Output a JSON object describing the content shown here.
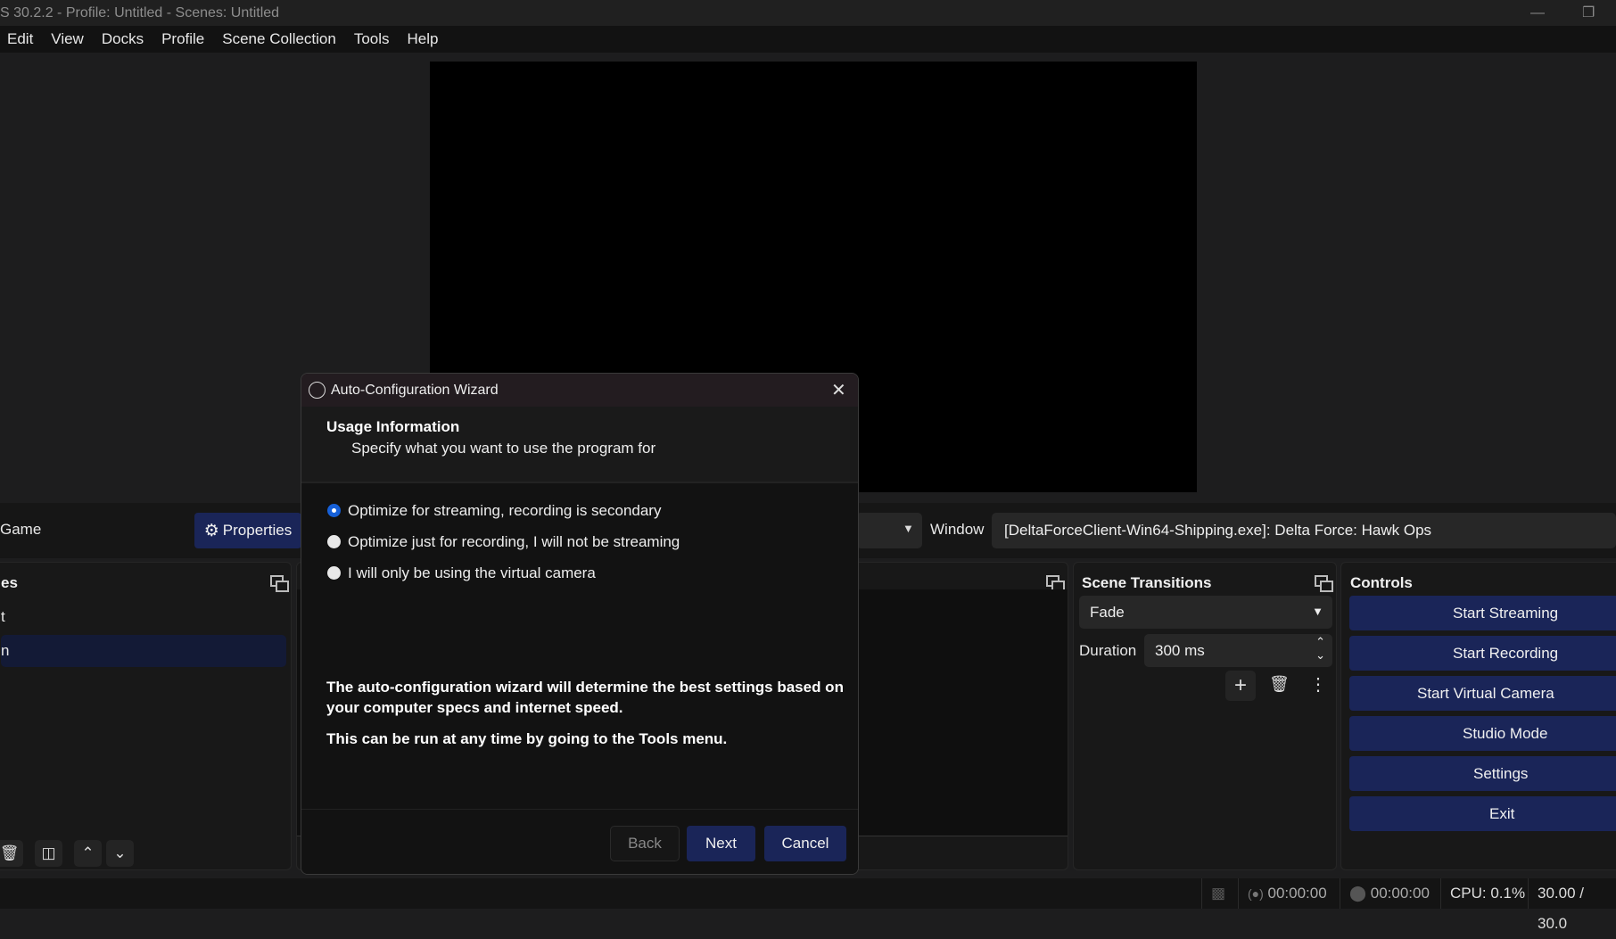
{
  "window": {
    "title": "S 30.2.2 - Profile: Untitled - Scenes: Untitled"
  },
  "menu": [
    "Edit",
    "View",
    "Docks",
    "Profile",
    "Scene Collection",
    "Tools",
    "Help"
  ],
  "source_toolbar": {
    "source_name": "Game",
    "properties_label": "Properties",
    "window_label": "Window",
    "window_value": "[DeltaForceClient-Win64-Shipping.exe]: Delta Force: Hawk Ops"
  },
  "scenes_dock": {
    "title": "es",
    "items": [
      "t",
      "n"
    ],
    "selected_index": 1
  },
  "transitions": {
    "title": "Scene Transitions",
    "transition": "Fade",
    "duration_label": "Duration",
    "duration_value": "300 ms"
  },
  "controls": {
    "title": "Controls",
    "buttons": [
      "Start Streaming",
      "Start Recording",
      "Start Virtual Camera",
      "Studio Mode",
      "Settings",
      "Exit"
    ]
  },
  "status": {
    "stream_time": "00:00:00",
    "record_time": "00:00:00",
    "cpu": "CPU: 0.1%",
    "fps": "30.00 / 30.0"
  },
  "dialog": {
    "title": "Auto-Configuration Wizard",
    "heading": "Usage Information",
    "subheading": "Specify what you want to use the program for",
    "options": [
      "Optimize for streaming, recording is secondary",
      "Optimize just for recording, I will not be streaming",
      "I will only be using the virtual camera"
    ],
    "selected_option": 0,
    "info1": "The auto-configuration wizard will determine the best settings based on your computer specs and internet speed.",
    "info2": "This can be run at any time by going to the Tools menu.",
    "back": "Back",
    "next": "Next",
    "cancel": "Cancel"
  },
  "colors": {
    "accent": "#1a2558",
    "radio_selected": "#1660d8"
  }
}
